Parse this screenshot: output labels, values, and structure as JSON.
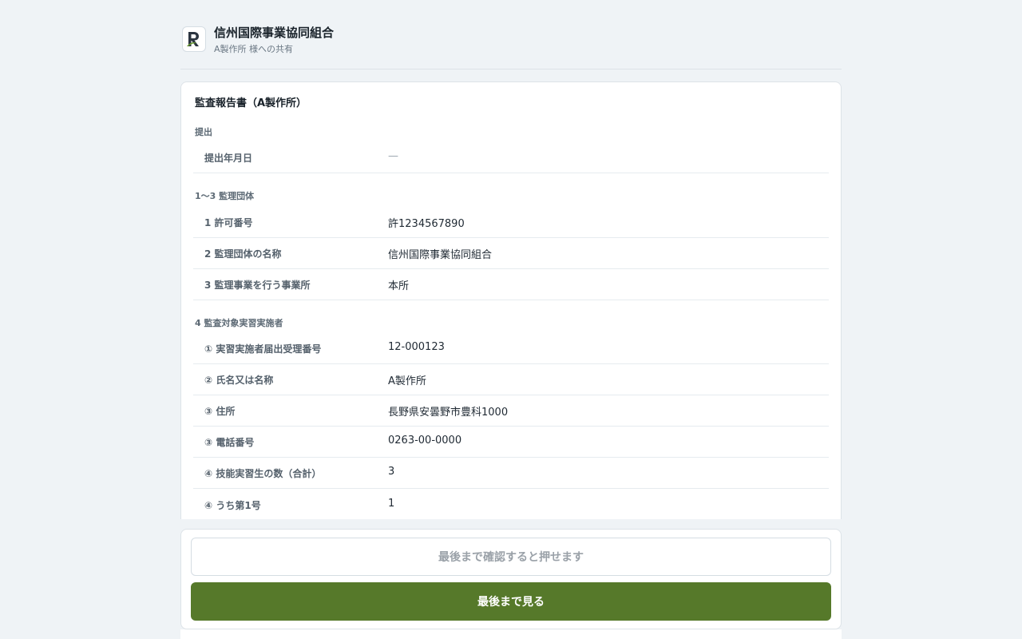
{
  "header": {
    "org_name": "信州国際事業協同組合",
    "share_note": "A製作所 様への共有"
  },
  "document": {
    "title": "監査報告書（A製作所）",
    "sections": [
      {
        "label": "提出",
        "rows": [
          {
            "label": "提出年月日",
            "value": "—"
          }
        ]
      },
      {
        "label": "1〜3 監理団体",
        "rows": [
          {
            "label": "1 許可番号",
            "value": "許1234567890"
          },
          {
            "label": "2 監理団体の名称",
            "value": "信州国際事業協同組合"
          },
          {
            "label": "3 監理事業を行う事業所",
            "value": "本所"
          }
        ]
      },
      {
        "label": "4 監査対象実習実施者",
        "rows": [
          {
            "label": "① 実習実施者届出受理番号",
            "value": "12-000123"
          },
          {
            "label": "② 氏名又は名称",
            "value": "A製作所"
          },
          {
            "label": "③ 住所",
            "value": "長野県安曇野市豊科1000"
          },
          {
            "label": "③ 電話番号",
            "value": "0263-00-0000"
          },
          {
            "label": "④ 技能実習生の数（合計）",
            "value": "3"
          },
          {
            "label": "④ うち第1号",
            "value": "1"
          }
        ]
      }
    ]
  },
  "actions": {
    "confirm_label": "最後まで確認すると押せます",
    "view_label": "最後まで見る"
  },
  "colors": {
    "accent": "#56792a",
    "background": "#eff3f6"
  }
}
